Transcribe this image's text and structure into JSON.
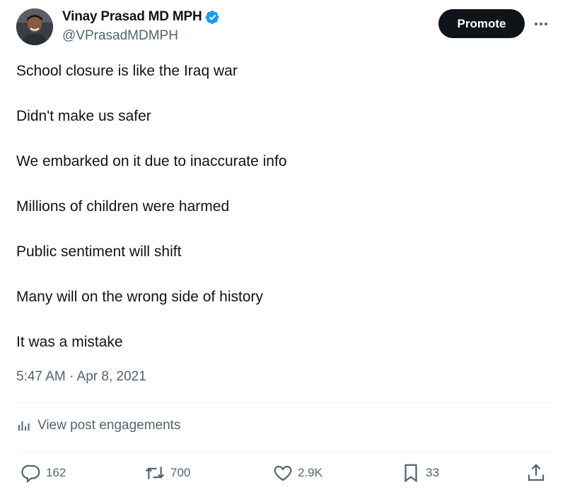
{
  "author": {
    "name": "Vinay Prasad MD MPH",
    "handle": "@VPrasadMDMPH",
    "verified": true
  },
  "header": {
    "promote_label": "Promote",
    "more_icon": "more-horizontal-icon"
  },
  "tweet": {
    "lines": [
      "School closure is like the Iraq war",
      "Didn't make us safer",
      "We embarked on it due to inaccurate info",
      "Millions of children were harmed",
      "Public sentiment will shift",
      "Many will on the wrong side of history",
      "It was a mistake"
    ],
    "timestamp": "5:47 AM · Apr 8, 2021"
  },
  "engagements": {
    "label": "View post engagements",
    "icon": "analytics-bars-icon"
  },
  "actions": {
    "replies": "162",
    "reposts": "700",
    "likes": "2.9K",
    "bookmarks": "33"
  },
  "colors": {
    "text": "#0f1419",
    "secondary": "#536471",
    "verified": "#1d9bf0",
    "divider": "#eff3f4",
    "button": "#0f1419"
  }
}
